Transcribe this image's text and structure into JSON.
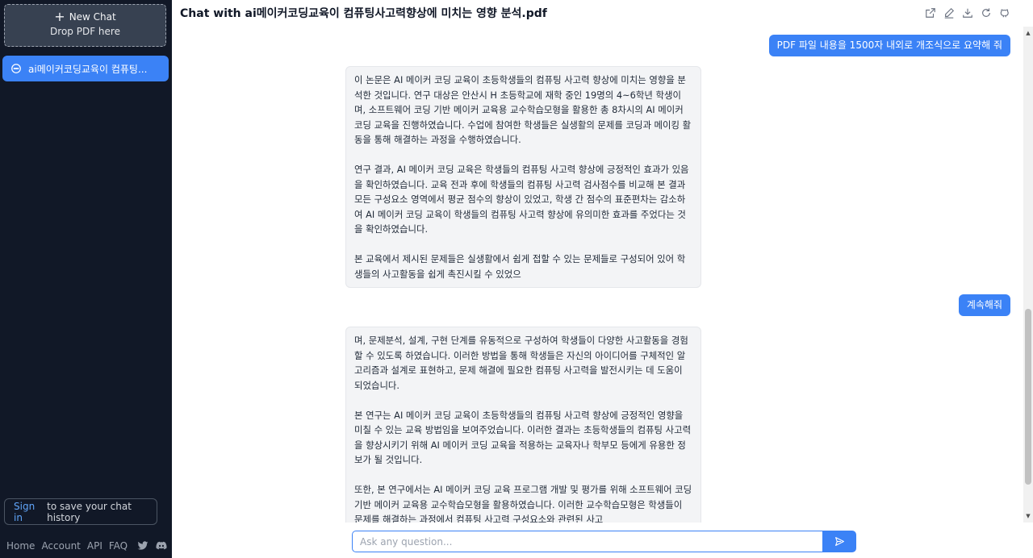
{
  "sidebar": {
    "new_chat_label": "New Chat",
    "drop_label": "Drop PDF here",
    "chats": [
      {
        "label": "ai메이커코딩교육이 컴퓨팅..."
      }
    ],
    "signin_link": "Sign in",
    "signin_text": "to save your chat history",
    "footer_links": [
      "Home",
      "Account",
      "API",
      "FAQ"
    ]
  },
  "header": {
    "title": "Chat with ai메이커코딩교육이 컴퓨팅사고력향상에 미치는 영향 분석.pdf"
  },
  "messages": [
    {
      "role": "user",
      "text": "PDF 파일 내용을 1500자 내외로 개조식으로 요약해 줘"
    },
    {
      "role": "assistant",
      "paragraphs": [
        "이 논문은 AI 메이커 코딩 교육이 초등학생들의 컴퓨팅 사고력 향상에 미치는 영향을 분석한 것입니다. 연구 대상은 안산시 H 초등학교에 재학 중인 19명의 4~6학년 학생이며, 소프트웨어 코딩 기반 메이커 교육용 교수학습모형을 활용한 총 8차시의 AI 메이커 코딩 교육을 진행하였습니다. 수업에 참여한 학생들은 실생활의 문제를 코딩과 메이킹 활동을 통해 해결하는 과정을 수행하였습니다.",
        "연구 결과, AI 메이커 코딩 교육은 학생들의 컴퓨팅 사고력 향상에 긍정적인 효과가 있음을 확인하였습니다. 교육 전과 후에 학생들의 컴퓨팅 사고력 검사점수를 비교해 본 결과 모든 구성요소 영역에서 평균 점수의 향상이 있었고, 학생 간 점수의 표준편차는 감소하여 AI 메이커 코딩 교육이 학생들의 컴퓨팅 사고력 향상에 유의미한 효과를 주었다는 것을 확인하였습니다.",
        "본 교육에서 제시된 문제들은 실생활에서 쉽게 접할 수 있는 문제들로 구성되어 있어 학생들의 사고활동을 쉽게 촉진시킬 수 있었으"
      ]
    },
    {
      "role": "user",
      "text": "계속해줘"
    },
    {
      "role": "assistant",
      "paragraphs": [
        "며, 문제분석, 설계, 구현 단계를 유동적으로 구성하여 학생들이 다양한 사고활동을 경험할 수 있도록 하였습니다. 이러한 방법을 통해 학생들은 자신의 아이디어를 구체적인 알고리즘과 설계로 표현하고, 문제 해결에 필요한 컴퓨팅 사고력을 발전시키는 데 도움이 되었습니다.",
        "본 연구는 AI 메이커 코딩 교육이 초등학생들의 컴퓨팅 사고력 향상에 긍정적인 영향을 미칠 수 있는 교육 방법임을 보여주었습니다. 이러한 결과는 초등학생들의 컴퓨팅 사고력을 향상시키기 위해 AI 메이커 코딩 교육을 적용하는 교육자나 학부모 등에게 유용한 정보가 될 것입니다.",
        "또한, 본 연구에서는 AI 메이커 코딩 교육 프로그램 개발 및 평가를 위해 소프트웨어 코딩 기반 메이커 교육용 교수학습모형을 활용하였습니다. 이러한 교수학습모형은 학생들이 문제를 해결하는 과정에서 컴퓨팅 사고력 구성요소와 관련된 사고"
      ]
    }
  ],
  "input": {
    "placeholder": "Ask any question..."
  },
  "icons": {
    "toolbar": [
      "share-icon",
      "edit-icon",
      "download-icon",
      "refresh-icon",
      "github-icon"
    ],
    "social": [
      "twitter-icon",
      "discord-icon"
    ],
    "send": "send-icon"
  },
  "colors": {
    "sidebar_bg": "#111827",
    "accent": "#3b82f6",
    "bubble_bg": "#f3f4f6"
  }
}
